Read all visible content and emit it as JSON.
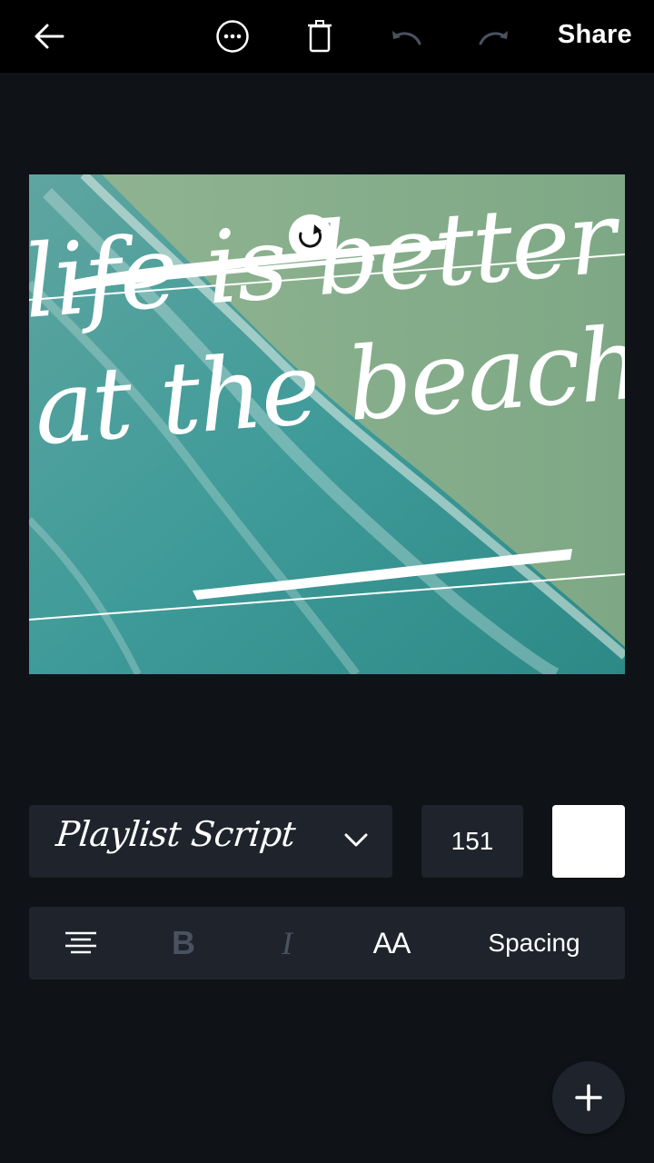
{
  "toolbar": {
    "back_icon": "arrow-left-icon",
    "more_icon": "more-horizontal-circle-icon",
    "delete_icon": "trash-icon",
    "undo_icon": "undo-icon",
    "redo_icon": "redo-icon",
    "share_label": "Share"
  },
  "design": {
    "line1": "life is better",
    "line2": "at the beach",
    "rotate_icon": "rotate-icon"
  },
  "text_controls": {
    "font_name": "Playlist Script",
    "font_size": "151",
    "text_color": "#ffffff",
    "align_icon": "align-center-icon",
    "bold_label": "B",
    "italic_label": "I",
    "case_label": "AA",
    "spacing_label": "Spacing"
  },
  "fab": {
    "icon": "plus-icon"
  },
  "colors": {
    "topbar": "#000000",
    "background": "#0f1318",
    "panel": "#1e232c",
    "disabled": "#4a5260"
  }
}
